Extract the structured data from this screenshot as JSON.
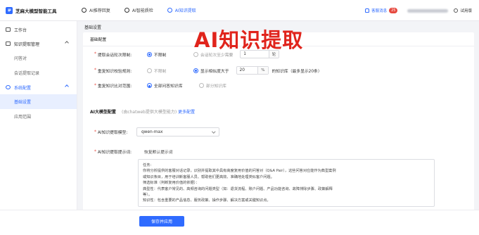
{
  "app": {
    "title": "芝麻大模型智能工具"
  },
  "tabs": [
    {
      "label": "AI推荐回复",
      "icon": "reply-icon"
    },
    {
      "label": "AI智能质检",
      "icon": "inspect-icon"
    },
    {
      "label": "AI知识提取",
      "icon": "extract-icon",
      "active": true
    }
  ],
  "topright": {
    "service": "客服消息",
    "badge": "25",
    "user": "试用版"
  },
  "sidebar": {
    "workspace": "工作台",
    "knowledge_group": "知识提取管理",
    "qa": "问答对",
    "extract_records": "会话提取记录",
    "system_group": "系统配置",
    "basic_settings": "基础设置",
    "scope": "应用范围"
  },
  "breadcrumb": "基础设置",
  "card": {
    "title": "基础配置"
  },
  "form": {
    "row1": {
      "label": "提取会话轮次限制:",
      "opt1": "不限制",
      "opt2": "会话轮次至少需要",
      "value": "1",
      "unit": "轮"
    },
    "row2": {
      "label": "重复知识校验规则:",
      "opt1": "不限制",
      "opt2": "显示相似度大于",
      "value": "20",
      "unit": "%",
      "suffix": "的知识库（最多显示20条）"
    },
    "row3": {
      "label": "重复知识比对范围:",
      "opt1": "全部问答知识库",
      "opt2": "部分知识库"
    }
  },
  "ai_section": {
    "title": "AI大模型配置",
    "note": "(由chatweb提供大模型能力)",
    "link": "更多配置"
  },
  "model": {
    "label": "AI知识提取模型:",
    "value": "qwen-max"
  },
  "prompt": {
    "label": "AI知识提取提示词:",
    "reset": "恢复默认提示词",
    "lines": [
      "任务:",
      "你将分析提供的客服对话记录，识别并提取其中具有高度复用价值的问答对（Q&A Pair），这些问答对应能作为典型案例",
      "或知识条目，用于培训新客服人员、帮助他们更高效、准确地处理类似客户问题。",
      "筛选标准（判断复用价值的依据）：",
      "典型性：代表客户常见的、高频咨询的问题类型（如：退货流程、账户问题、产品功能咨询、故障排除步骤、政策解释",
      "等）。",
      "知识性：包含重要的产品信息、服务政策、操作步骤、解决方案或关键知识点。"
    ]
  },
  "footer": {
    "save": "保存并应用"
  },
  "overlay": {
    "text": "AI知识提取"
  },
  "colors": {
    "accent": "#2f6bff",
    "overlay": "#e0241c",
    "badge": "#e6493f"
  }
}
